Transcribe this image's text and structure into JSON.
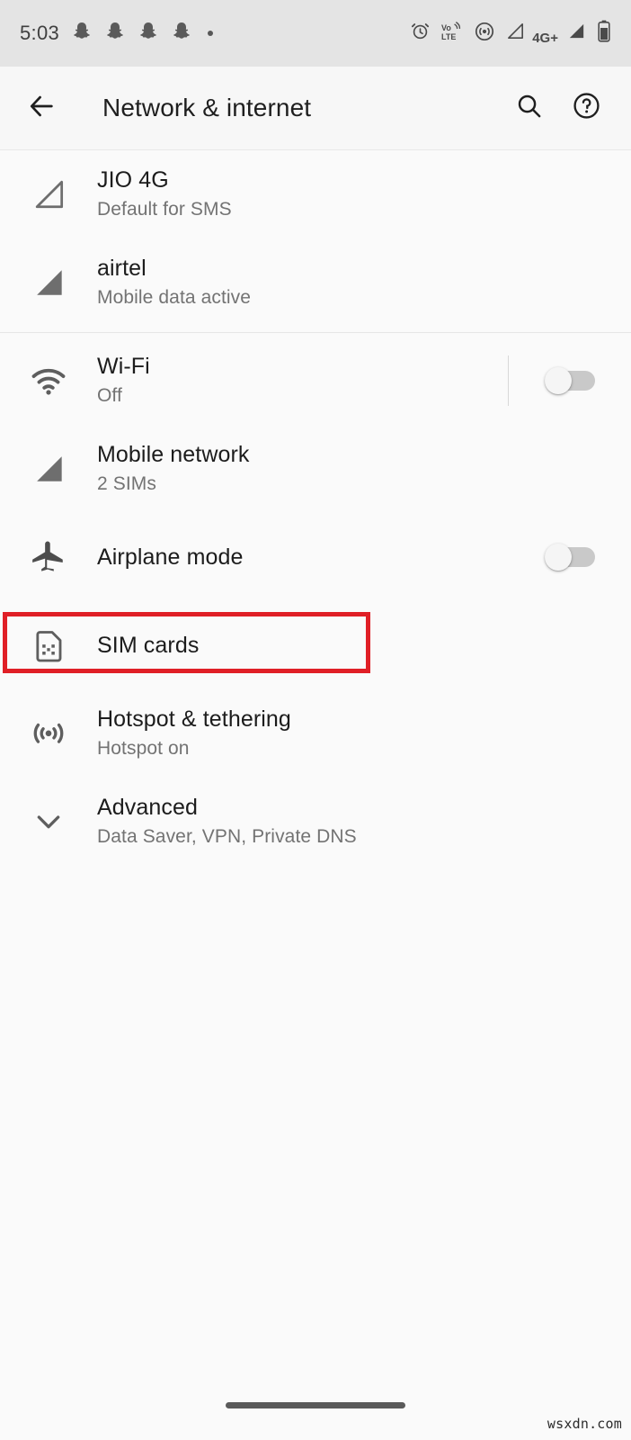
{
  "status_bar": {
    "time": "5:03",
    "left_icons": [
      "snapchat-ghost-icon",
      "snapchat-ghost-icon",
      "snapchat-ghost-icon",
      "snapchat-ghost-icon",
      "more-notifications-dot"
    ],
    "right_icons": [
      "alarm-icon",
      "volte-icon",
      "hotspot-icon",
      "signal-sim1-icon",
      "signal-sim2-icon",
      "battery-icon"
    ],
    "network_label": "4G+",
    "volte_top": "Vo",
    "volte_bottom": "LTE"
  },
  "app_bar": {
    "back_icon": "back-arrow-icon",
    "title": "Network & internet",
    "search_icon": "search-icon",
    "help_icon": "help-icon"
  },
  "sim_section": [
    {
      "icon": "signal-outline-icon",
      "title": "JIO 4G",
      "subtitle": "Default for SMS"
    },
    {
      "icon": "signal-filled-icon",
      "title": "airtel",
      "subtitle": "Mobile data active"
    }
  ],
  "settings_section": [
    {
      "icon": "wifi-icon",
      "title": "Wi-Fi",
      "subtitle": "Off",
      "toggle": "off",
      "has_divider": true
    },
    {
      "icon": "signal-filled-icon",
      "title": "Mobile network",
      "subtitle": "2 SIMs",
      "toggle": null,
      "has_divider": false
    },
    {
      "icon": "airplane-icon",
      "title": "Airplane mode",
      "subtitle": "",
      "toggle": "off",
      "has_divider": false
    },
    {
      "icon": "sim-card-icon",
      "title": "SIM cards",
      "subtitle": "",
      "toggle": null,
      "has_divider": false
    },
    {
      "icon": "hotspot-icon",
      "title": "Hotspot & tethering",
      "subtitle": "Hotspot on",
      "toggle": null,
      "has_divider": false
    },
    {
      "icon": "chevron-down-icon",
      "title": "Advanced",
      "subtitle": "Data Saver, VPN, Private DNS",
      "toggle": null,
      "has_divider": false
    }
  ],
  "annotation": {
    "target": "SIM cards",
    "color": "#e01f26"
  },
  "nav_bar": {
    "home_indicator": "home-gesture-bar"
  },
  "watermark": "wsxdn.com",
  "colors": {
    "status_bar_bg": "#e4e4e4",
    "app_bar_bg": "#f7f7f7",
    "page_bg": "#fafafa",
    "title_text": "#1c1c1c",
    "subtitle_text": "#737373",
    "annotation_red": "#e01f26"
  }
}
